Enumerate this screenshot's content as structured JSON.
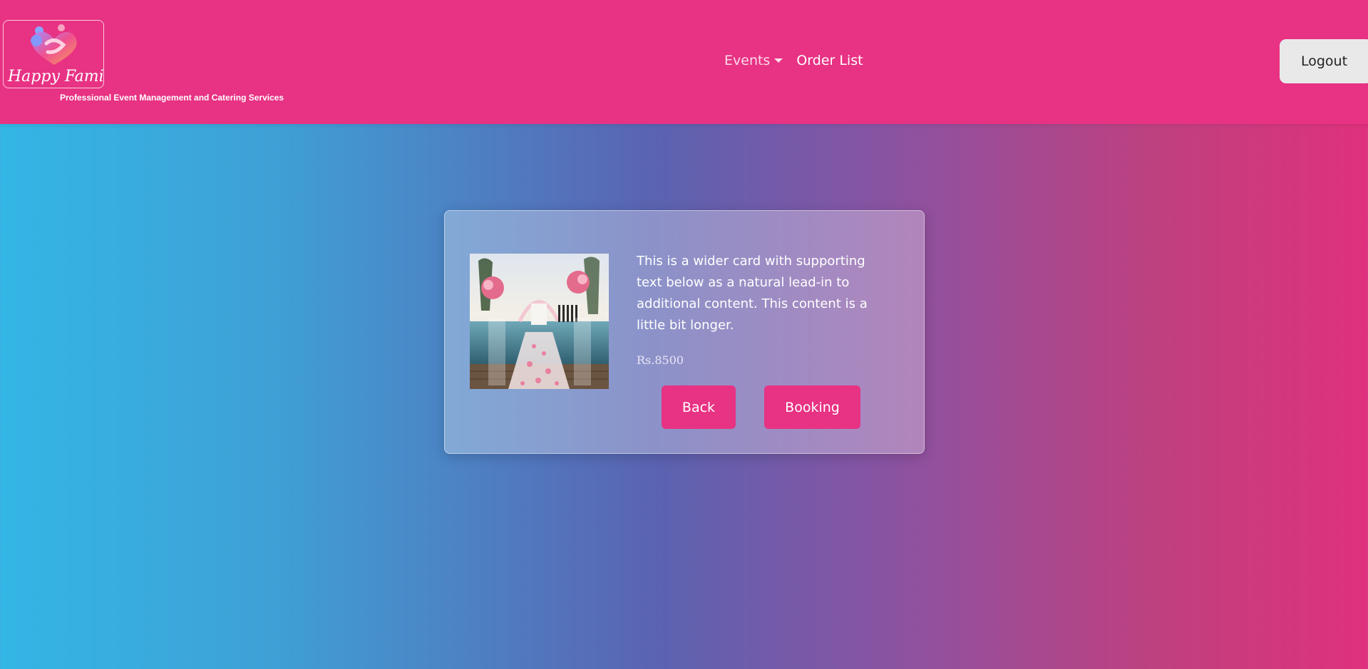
{
  "header": {
    "logo_text": "Happy Family",
    "tagline": "Professional Event Management and Catering Services",
    "nav": {
      "events_label": "Events",
      "order_list_label": "Order List"
    },
    "logout_label": "Logout"
  },
  "card": {
    "description": "This is a wider card with supporting text below as a natural lead-in to additional content. This content is a little bit longer.",
    "price": "Rs.8500",
    "back_label": "Back",
    "booking_label": "Booking"
  },
  "colors": {
    "brand_pink": "#e83283",
    "gradient_start": "#33b6e5",
    "gradient_end": "#df317d"
  }
}
